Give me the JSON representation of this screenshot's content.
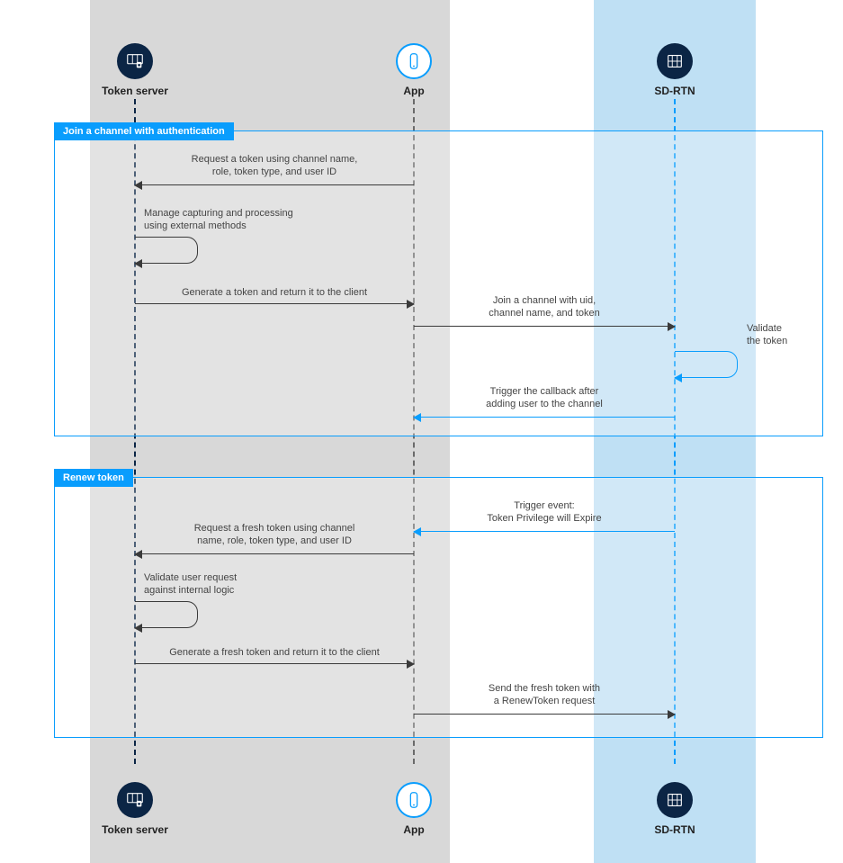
{
  "actors": {
    "token_server": "Token server",
    "app": "App",
    "sdrtn": "SD-RTN"
  },
  "groups": {
    "join": "Join a channel with authentication",
    "renew": "Renew token"
  },
  "messages": {
    "request_token": "Request a token using channel name,\nrole, token type, and user ID",
    "manage_capturing": "Manage capturing and processing\nusing external methods",
    "generate_token": "Generate a token and return it to the client",
    "join_channel": "Join a channel with uid,\nchannel name, and token",
    "validate_token": "Validate\nthe token",
    "trigger_callback": "Trigger the callback after\nadding user to the channel",
    "trigger_event": "Trigger event:\nToken Privilege will Expire",
    "request_fresh": "Request a fresh token using channel\nname, role, token type, and user ID",
    "validate_user": "Validate user request\nagainst internal logic",
    "generate_fresh": "Generate a fresh token and return it to the client",
    "send_fresh": "Send the fresh token with\na RenewToken request"
  }
}
